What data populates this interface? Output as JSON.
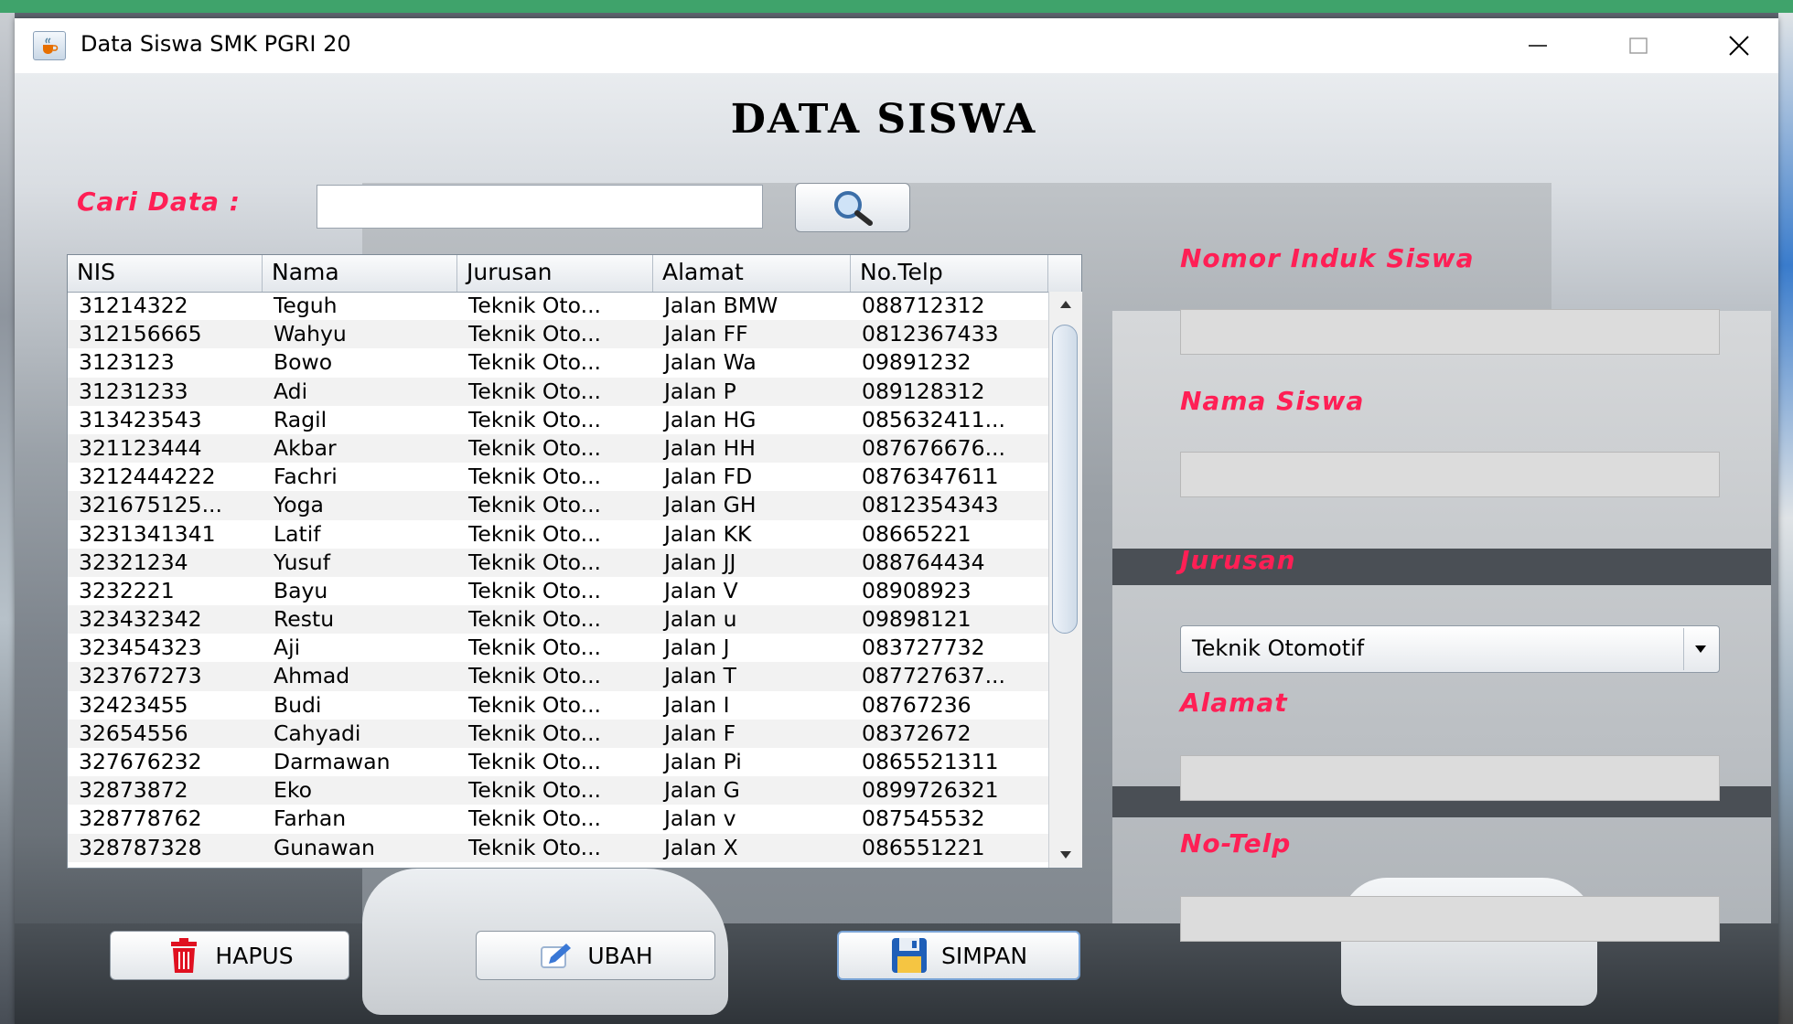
{
  "window": {
    "title": "Data Siswa SMK PGRI 20"
  },
  "heading": "DATA SISWA",
  "search": {
    "label": "Cari Data :",
    "value": ""
  },
  "table": {
    "columns": [
      "NIS",
      "Nama",
      "Jurusan",
      "Alamat",
      "No.Telp"
    ],
    "rows": [
      [
        "31214322",
        "Teguh",
        "Teknik Oto...",
        "Jalan BMW",
        "088712312"
      ],
      [
        "312156665",
        "Wahyu",
        "Teknik Oto...",
        "Jalan FF",
        "0812367433"
      ],
      [
        "3123123",
        "Bowo",
        "Teknik Oto...",
        "Jalan Wa",
        "09891232"
      ],
      [
        "31231233",
        "Adi",
        "Teknik Oto...",
        "Jalan P",
        "089128312"
      ],
      [
        "313423543",
        "Ragil",
        "Teknik Oto...",
        "Jalan HG",
        "085632411..."
      ],
      [
        "321123444",
        "Akbar",
        "Teknik Oto...",
        "Jalan HH",
        "087676676..."
      ],
      [
        "3212444222",
        "Fachri",
        "Teknik Oto...",
        "Jalan FD",
        "0876347611"
      ],
      [
        "321675125...",
        "Yoga",
        "Teknik Oto...",
        "Jalan GH",
        "0812354343"
      ],
      [
        "3231341341",
        "Latif",
        "Teknik Oto...",
        "Jalan KK",
        "08665221"
      ],
      [
        "32321234",
        "Yusuf",
        "Teknik Oto...",
        "Jalan JJ",
        "088764434"
      ],
      [
        "3232221",
        "Bayu",
        "Teknik Oto...",
        "Jalan V",
        "08908923"
      ],
      [
        "323432342",
        "Restu",
        "Teknik Oto...",
        "Jalan u",
        "09898121"
      ],
      [
        "323454323",
        "Aji",
        "Teknik Oto...",
        "Jalan J",
        "083727732"
      ],
      [
        "323767273",
        "Ahmad",
        "Teknik Oto...",
        "Jalan T",
        "087727637..."
      ],
      [
        "32423455",
        "Budi",
        "Teknik Oto...",
        "Jalan I",
        "08767236"
      ],
      [
        "32654556",
        "Cahyadi",
        "Teknik Oto...",
        "Jalan F",
        "08372672"
      ],
      [
        "327676232",
        "Darmawan",
        "Teknik Oto...",
        "Jalan Pi",
        "0865521311"
      ],
      [
        "32873872",
        "Eko",
        "Teknik Oto...",
        "Jalan G",
        "0899726321"
      ],
      [
        "328778762",
        "Farhan",
        "Teknik Oto...",
        "Jalan v",
        "087545532"
      ],
      [
        "328787328",
        "Gunawan",
        "Teknik Oto...",
        "Jalan X",
        "086551221"
      ]
    ]
  },
  "form": {
    "nis_label": "Nomor Induk Siswa",
    "nis_value": "",
    "nama_label": "Nama Siswa",
    "nama_value": "",
    "jurusan_label": "Jurusan",
    "jurusan_selected": "Teknik Otomotif",
    "alamat_label": "Alamat",
    "alamat_value": "",
    "telp_label": "No-Telp",
    "telp_value": ""
  },
  "buttons": {
    "hapus": "HAPUS",
    "ubah": "UBAH",
    "simpan": "SIMPAN"
  },
  "icons": {
    "app": "java-cup-icon",
    "search": "magnifier-icon",
    "hapus": "trash-icon",
    "ubah": "pencil-icon",
    "simpan": "floppy-disk-icon"
  },
  "colors": {
    "label_red": "#ff1f55",
    "heading": "#000000",
    "desktop_green": "#3fa36b"
  }
}
